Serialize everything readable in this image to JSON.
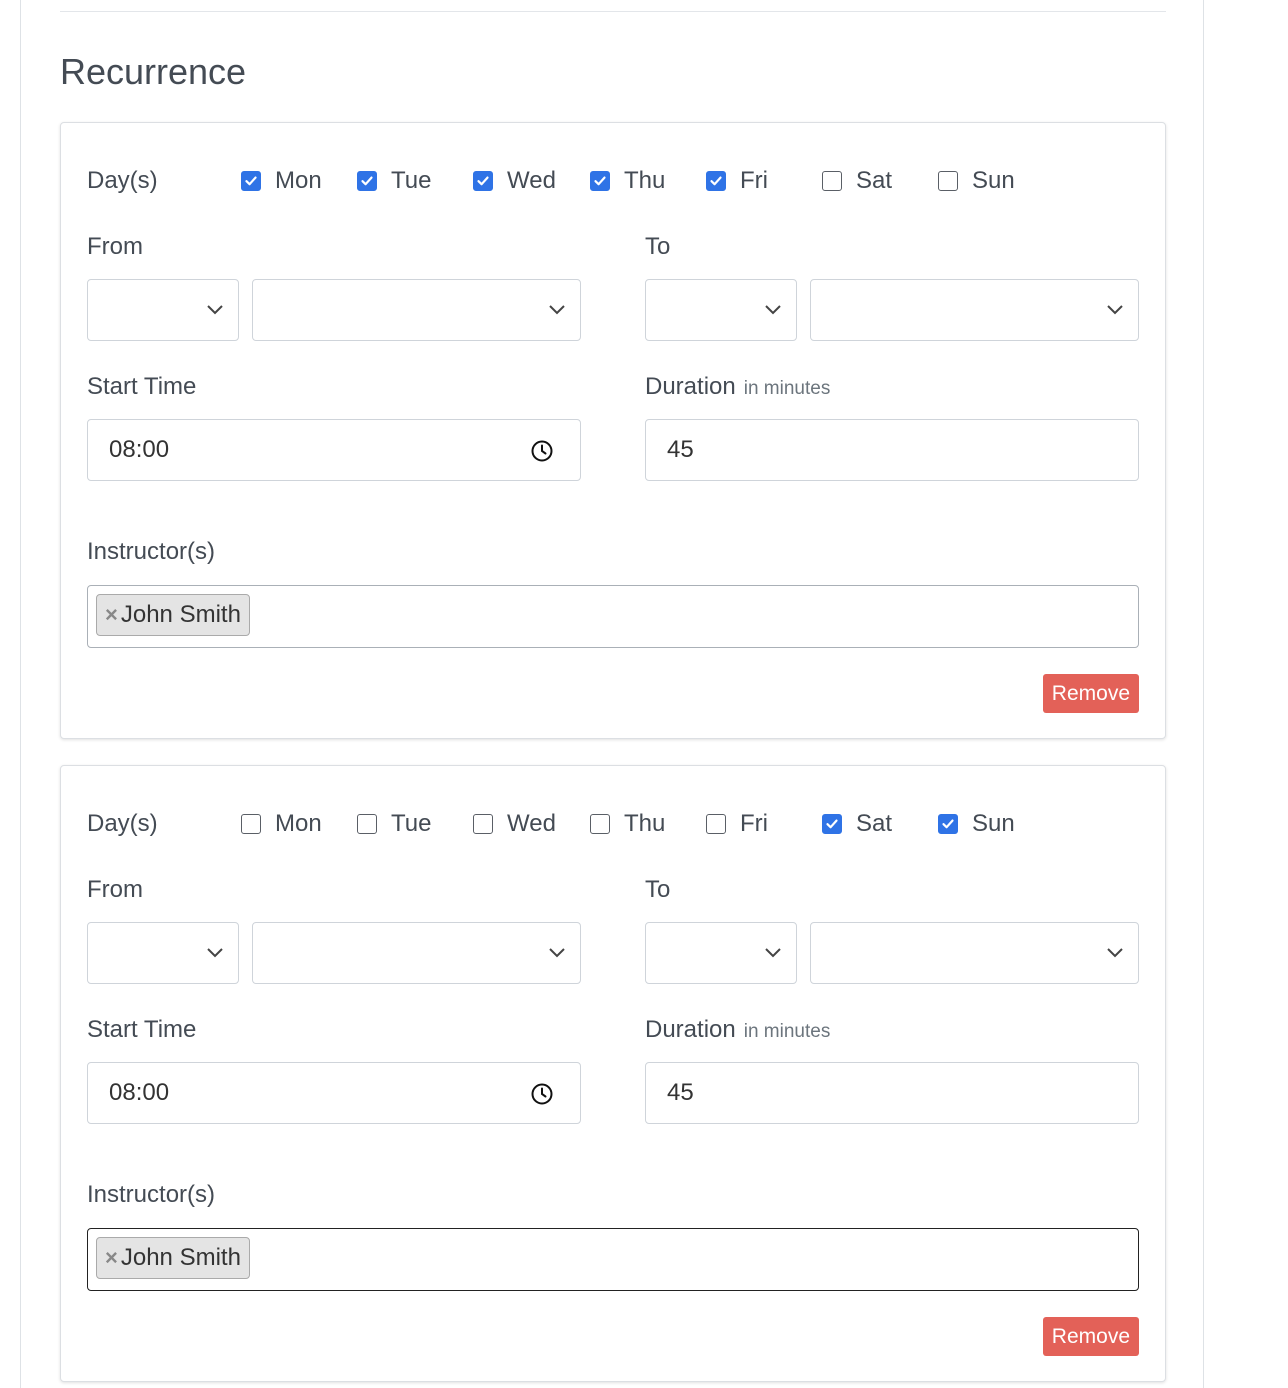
{
  "section_title": "Recurrence",
  "labels": {
    "days": "Day(s)",
    "from": "From",
    "to": "To",
    "start_time": "Start Time",
    "duration": "Duration",
    "duration_hint": "in minutes",
    "instructors": "Instructor(s)",
    "remove": "Remove"
  },
  "colors": {
    "checkbox_checked": "#2f73e6",
    "remove_button": "#e36158"
  },
  "recurrences": [
    {
      "days": [
        {
          "label": "Mon",
          "checked": true
        },
        {
          "label": "Tue",
          "checked": true
        },
        {
          "label": "Wed",
          "checked": true
        },
        {
          "label": "Thu",
          "checked": true
        },
        {
          "label": "Fri",
          "checked": true
        },
        {
          "label": "Sat",
          "checked": false
        },
        {
          "label": "Sun",
          "checked": false
        }
      ],
      "start_time": "08:00",
      "duration": "45",
      "instructors": [
        "John Smith"
      ],
      "tag_remove_glyph": "×"
    },
    {
      "days": [
        {
          "label": "Mon",
          "checked": false
        },
        {
          "label": "Tue",
          "checked": false
        },
        {
          "label": "Wed",
          "checked": false
        },
        {
          "label": "Thu",
          "checked": false
        },
        {
          "label": "Fri",
          "checked": false
        },
        {
          "label": "Sat",
          "checked": true
        },
        {
          "label": "Sun",
          "checked": true
        }
      ],
      "start_time": "08:00",
      "duration": "45",
      "instructors": [
        "John Smith"
      ],
      "tag_remove_glyph": "×"
    }
  ]
}
